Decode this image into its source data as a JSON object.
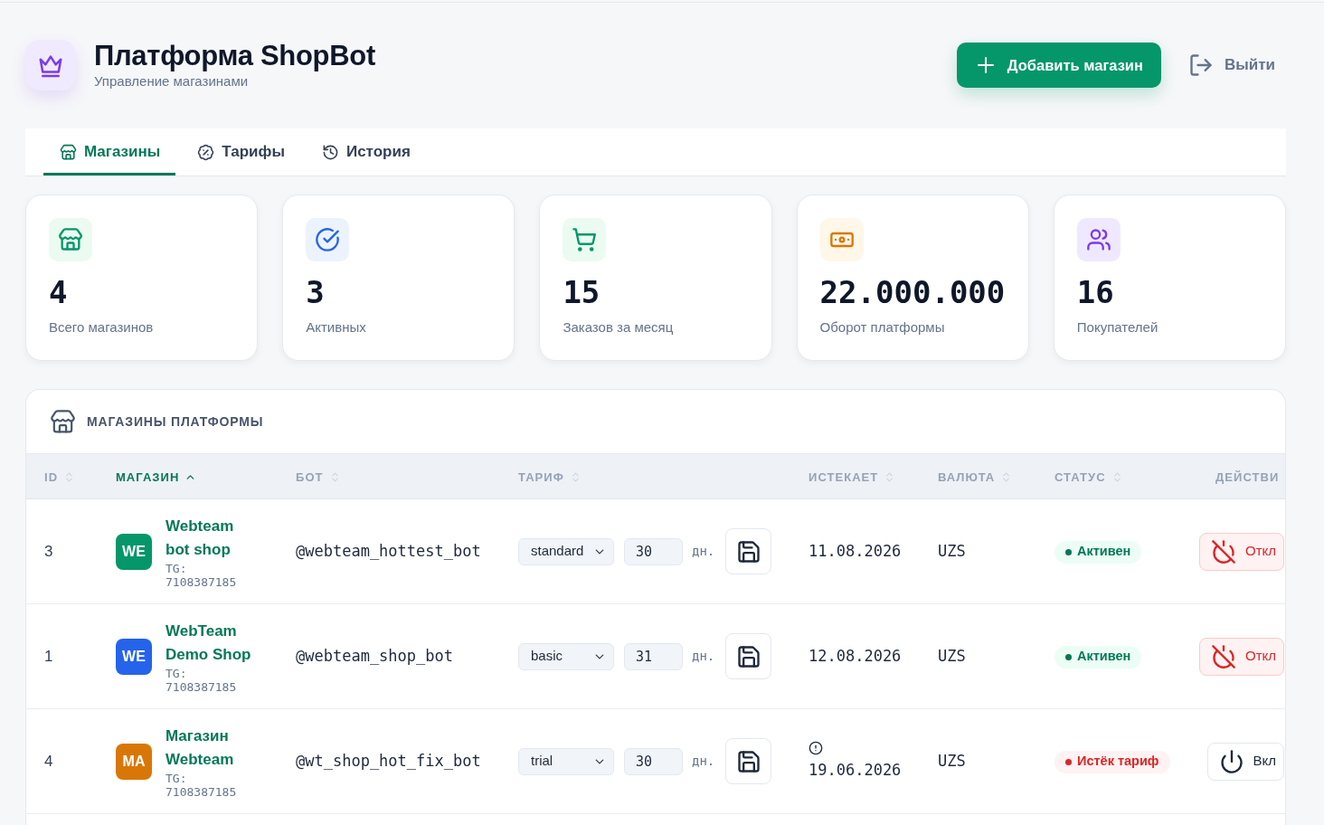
{
  "header": {
    "title": "Платформа ShopBot",
    "subtitle": "Управление магазинами",
    "add_button": "Добавить магазин",
    "logout_button": "Выйти"
  },
  "tabs": [
    {
      "kind": "shops",
      "label": "Магазины",
      "selected": true
    },
    {
      "kind": "tariffs",
      "label": "Тарифы",
      "selected": false
    },
    {
      "kind": "history",
      "label": "История",
      "selected": false
    }
  ],
  "stats": [
    {
      "kind": "shops",
      "value": "4",
      "label": "Всего магазинов"
    },
    {
      "kind": "active",
      "value": "3",
      "label": "Активных"
    },
    {
      "kind": "orders",
      "value": "15",
      "label": "Заказов за месяц"
    },
    {
      "kind": "turnover",
      "value": "22.000.000",
      "label": "Оборот платформы"
    },
    {
      "kind": "customers",
      "value": "16",
      "label": "Покупателей"
    }
  ],
  "shop_table": {
    "title": "МАГАЗИНЫ ПЛАТФОРМЫ",
    "columns": [
      {
        "label": "ID",
        "sortable": true,
        "sorted": false
      },
      {
        "label": "МАГАЗИН",
        "sortable": true,
        "sorted": true
      },
      {
        "label": "БОТ",
        "sortable": true,
        "sorted": false
      },
      {
        "label": "ТАРИФ",
        "sortable": true,
        "sorted": false
      },
      {
        "label": "ИСТЕКАЕТ",
        "sortable": true,
        "sorted": false
      },
      {
        "label": "ВАЛЮТА",
        "sortable": true,
        "sorted": false
      },
      {
        "label": "СТАТУС",
        "sortable": true,
        "sorted": false
      },
      {
        "label": "ДЕЙСТВИ",
        "sortable": false,
        "sorted": false
      }
    ],
    "rows": [
      {
        "id": "3",
        "avatar": "WE",
        "color": "#059669",
        "name": "Webteam bot shop",
        "tg": "TG: 7108387185",
        "bot": "@webteam_hottest_bot",
        "plan": "standard",
        "days": "30",
        "days_unit": "дн.",
        "expires": "11.08.2026",
        "expires_warning": false,
        "currency": "UZS",
        "status": {
          "kind": "active",
          "label": "Активен"
        },
        "action": {
          "kind": "disable",
          "label": "Откл"
        }
      },
      {
        "id": "1",
        "avatar": "WE",
        "color": "#2563eb",
        "name": "WebTeam Demo Shop",
        "tg": "TG: 7108387185",
        "bot": "@webteam_shop_bot",
        "plan": "basic",
        "days": "31",
        "days_unit": "дн.",
        "expires": "12.08.2026",
        "expires_warning": false,
        "currency": "UZS",
        "status": {
          "kind": "active",
          "label": "Активен"
        },
        "action": {
          "kind": "disable",
          "label": "Откл"
        }
      },
      {
        "id": "4",
        "avatar": "MA",
        "color": "#d97706",
        "name": "Магазин Webteam",
        "tg": "TG: 7108387185",
        "bot": "@wt_shop_hot_fix_bot",
        "plan": "trial",
        "days": "30",
        "days_unit": "дн.",
        "expires": "19.06.2026",
        "expires_warning": true,
        "currency": "UZS",
        "status": {
          "kind": "expired",
          "label": "Истёк тариф"
        },
        "action": {
          "kind": "enable",
          "label": "Вкл"
        }
      }
    ]
  }
}
